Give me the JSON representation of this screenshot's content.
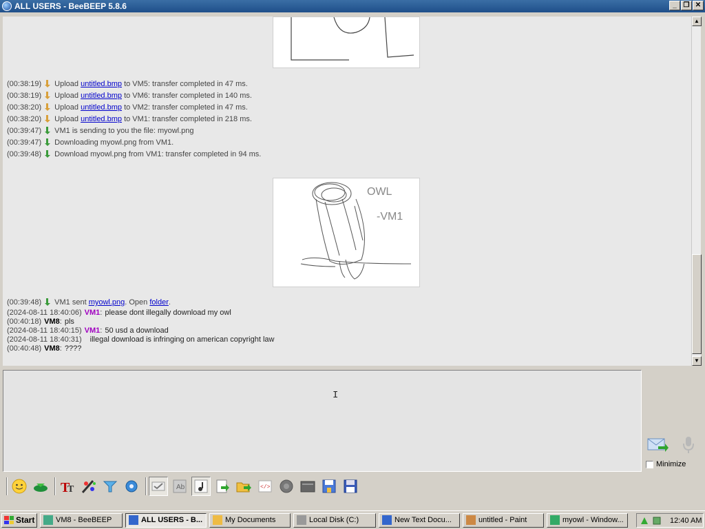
{
  "window": {
    "title": "ALL USERS - BeeBEEP 5.8.6",
    "controls": {
      "minimize": "_",
      "restore": "❐",
      "close": "✕"
    }
  },
  "chat": {
    "messages": [
      {
        "time": "(00:38:19)",
        "icon": "upload-icon",
        "pre": "Upload ",
        "link": "untitled.bmp",
        "post": " to VM5: transfer completed in 47 ms."
      },
      {
        "time": "(00:38:19)",
        "icon": "upload-icon",
        "pre": "Upload ",
        "link": "untitled.bmp",
        "post": " to VM6: transfer completed in 140 ms."
      },
      {
        "time": "(00:38:20)",
        "icon": "upload-icon",
        "pre": "Upload ",
        "link": "untitled.bmp",
        "post": " to VM2: transfer completed in 47 ms."
      },
      {
        "time": "(00:38:20)",
        "icon": "upload-icon",
        "pre": "Upload ",
        "link": "untitled.bmp",
        "post": " to VM1: transfer completed in 218 ms."
      },
      {
        "time": "(00:39:47)",
        "icon": "download-icon",
        "text": "VM1 is sending to you the file: myowl.png"
      },
      {
        "time": "(00:39:47)",
        "icon": "download-icon",
        "text": "Downloading myowl.png from VM1."
      },
      {
        "time": "(00:39:48)",
        "icon": "download-icon",
        "text": "Download myowl.png from VM1: transfer completed in 94 ms."
      }
    ],
    "sent_notice": {
      "time": "(00:39:48)",
      "pre": "VM1 sent ",
      "file": "myowl.png",
      "mid": ". Open ",
      "folder": "folder",
      "post": "."
    },
    "chat_lines": [
      {
        "time": "(2024-08-11 18:40:06)",
        "user": "VM1",
        "text": "please dont illegally download my owl"
      },
      {
        "time": "(00:40:18)",
        "user": "VM8",
        "text": "pls"
      },
      {
        "time": "(2024-08-11 18:40:15)",
        "user": "VM1",
        "text": "50 usd a download"
      },
      {
        "time": "(2024-08-11 18:40:31)",
        "user": "",
        "text": "illegal download is infringing on american copyright law"
      },
      {
        "time": "(00:40:48)",
        "user": "VM8",
        "text": "????"
      }
    ],
    "owl_drawing_text": [
      "OWL",
      "-VM1"
    ]
  },
  "input": {
    "minimize_label": "Minimize"
  },
  "toolbar": {
    "icons": [
      "emoticon-icon",
      "save-chat-icon",
      "font-icon",
      "font-color-icon",
      "filter-icon",
      "settings-icon",
      "spell-check-icon",
      "word-completion-icon",
      "sound-icon",
      "send-file-icon",
      "send-folder-icon",
      "code-icon",
      "record-icon",
      "screenshot-icon",
      "save-icon",
      "floppy-icon"
    ]
  },
  "taskbar": {
    "start": "Start",
    "tasks": [
      {
        "label": "VM8 - BeeBEEP",
        "active": false
      },
      {
        "label": "ALL USERS - B...",
        "active": true
      },
      {
        "label": "My Documents",
        "active": false
      },
      {
        "label": "Local Disk (C:)",
        "active": false
      },
      {
        "label": "New Text Docu...",
        "active": false
      },
      {
        "label": "untitled - Paint",
        "active": false
      },
      {
        "label": "myowl - Window...",
        "active": false
      }
    ],
    "clock": "12:40 AM"
  }
}
